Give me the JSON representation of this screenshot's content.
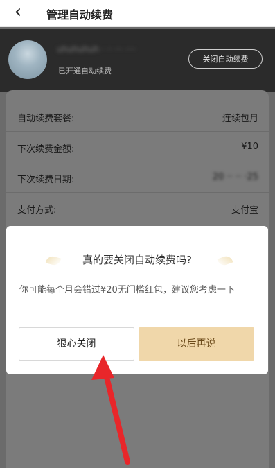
{
  "nav": {
    "back_label": "‹",
    "title": "管理自动续费"
  },
  "header": {
    "username": "uhuhuhuh · ·· ··· ····",
    "status": "已开通自动续费",
    "close_button": "关闭自动续费"
  },
  "details": [
    {
      "label": "自动续费套餐:",
      "value": "连续包月"
    },
    {
      "label": "下次续费金额:",
      "value": "¥10"
    },
    {
      "label": "下次续费日期:",
      "value": "20 ·· ·· ·25"
    },
    {
      "label": "支付方式:",
      "value": "支付宝"
    }
  ],
  "dialog": {
    "title": "真的要关闭自动续费吗?",
    "body": "你可能每个月会错过¥20无门槛红包，建议您考虑一下",
    "close_button": "狠心关闭",
    "later_button": "以后再说"
  },
  "colors": {
    "overlay": "#6b6b6b",
    "header_bg": "#2b2b2b",
    "accent_gold": "#f0d7aa",
    "arrow": "#e8262a"
  }
}
